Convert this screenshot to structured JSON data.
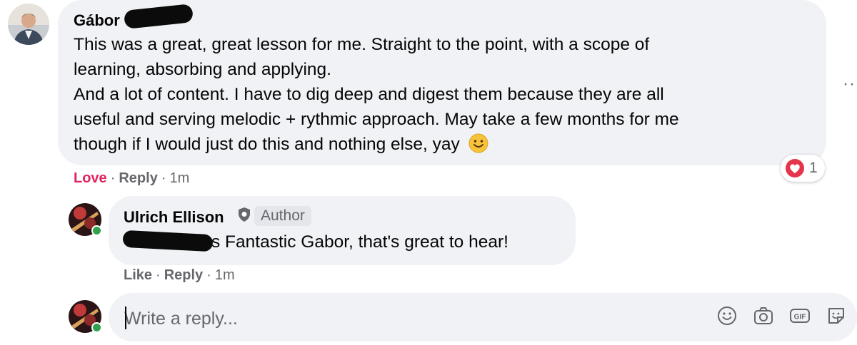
{
  "comments": [
    {
      "author": "Gábor",
      "text_lines": [
        "This was a great, great lesson for me. Straight to the point, with a scope of",
        "learning, absorbing and applying.",
        "And a lot of content. I have to dig deep and digest them because they are all",
        "useful and serving melodic + rythmic approach. May take a few months for me",
        "though if I would just do this and nothing else, yay"
      ],
      "emoji": "smiling-face-icon",
      "actions": {
        "love": "Love",
        "reply": "Reply",
        "time": "1m"
      },
      "reaction": {
        "icon": "heart-icon",
        "count": "1"
      }
    },
    {
      "author": "Ulrich Ellison",
      "badge": "Author",
      "text": "s Fantastic Gabor, that's great to hear!",
      "actions": {
        "like": "Like",
        "reply": "Reply",
        "time": "1m"
      }
    }
  ],
  "reply_box": {
    "placeholder": "Write a reply..."
  },
  "icons": [
    "emoji-icon",
    "camera-icon",
    "gif-icon",
    "sticker-icon",
    "more-icon"
  ],
  "colors": {
    "bubble": "#f0f2f5",
    "love": "#e0245e",
    "secondary_text": "#65676b",
    "online": "#31a24c",
    "heart": "#e4354a"
  }
}
